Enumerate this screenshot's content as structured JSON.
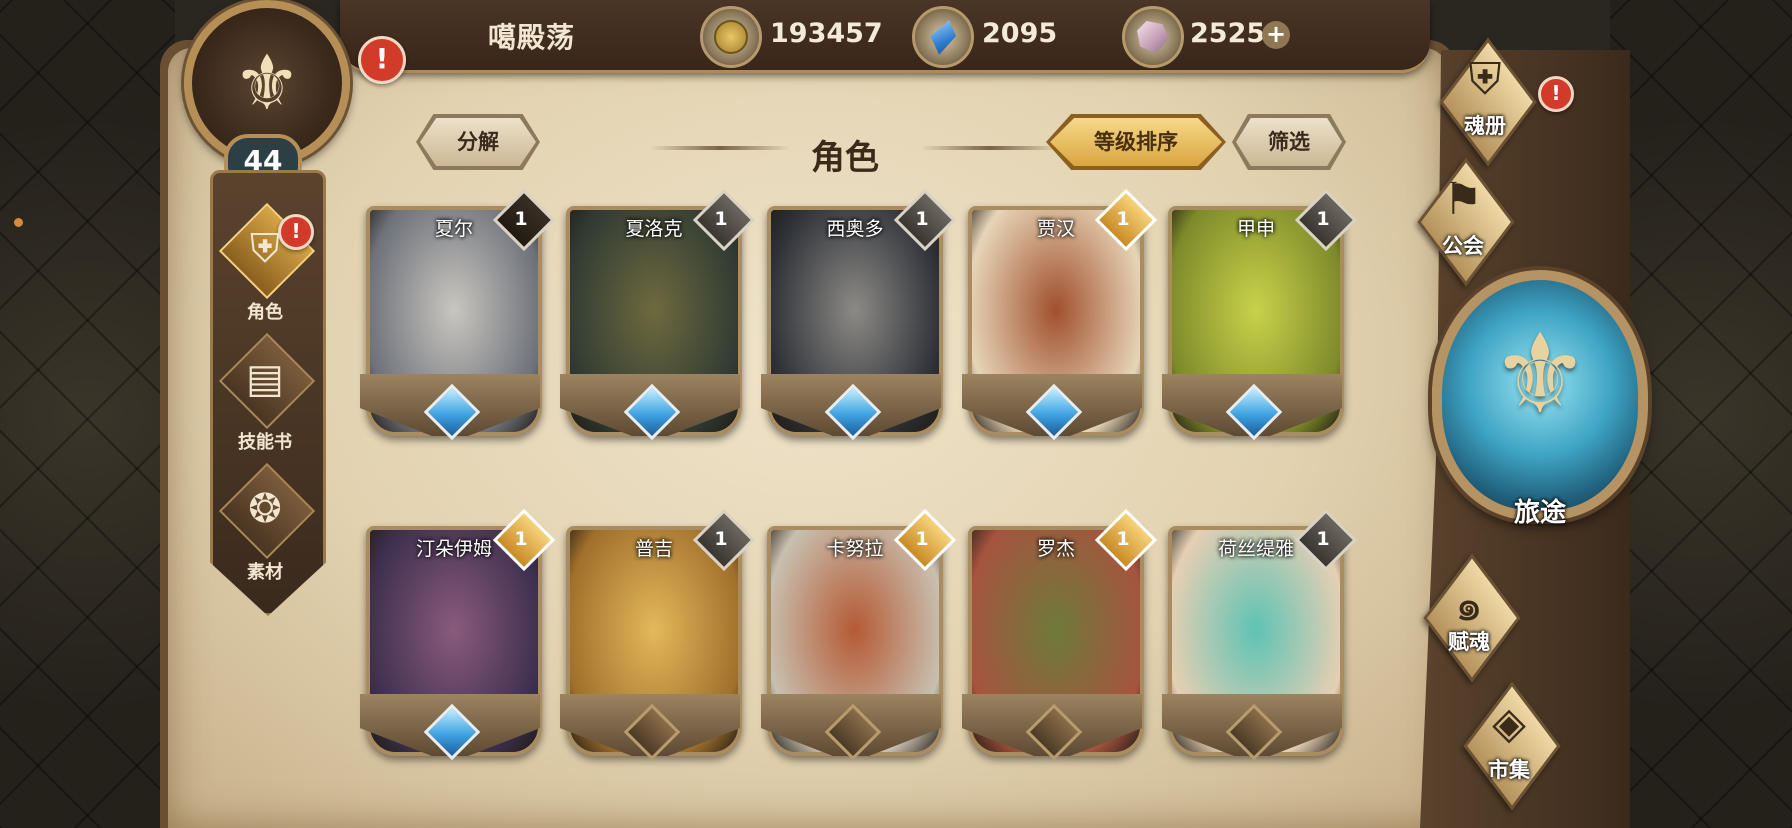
{
  "player": {
    "name": "噶殿荡",
    "level": "44",
    "alert": "!"
  },
  "resources": [
    {
      "icon": "gold-coin-icon",
      "value": "193457"
    },
    {
      "icon": "blue-gem-icon",
      "value": "2095"
    },
    {
      "icon": "crystal-icon",
      "value": "2525"
    }
  ],
  "plus_label": "+",
  "left_nav": [
    {
      "label": "角色",
      "icon": "helmet-icon",
      "alert": "!"
    },
    {
      "label": "技能书",
      "icon": "skill-book-icon"
    },
    {
      "label": "素材",
      "icon": "material-icon"
    }
  ],
  "toolbar": {
    "decompose": "分解",
    "sort": "等级排序",
    "filter": "筛选"
  },
  "page_title": "角色",
  "cards": [
    {
      "name": "夏尔",
      "count": "1",
      "tag": "dark",
      "gem": true,
      "colors": [
        "#c9c6c0",
        "#6d7179"
      ]
    },
    {
      "name": "夏洛克",
      "count": "1",
      "tag": "gray",
      "gem": true,
      "colors": [
        "#6e6a3e",
        "#2f3a33"
      ]
    },
    {
      "name": "西奥多",
      "count": "1",
      "tag": "gray",
      "gem": true,
      "colors": [
        "#8c8a86",
        "#2c2f35"
      ]
    },
    {
      "name": "贾汉",
      "count": "1",
      "tag": "gold",
      "gem": true,
      "colors": [
        "#a0502d",
        "#e7d5b8"
      ]
    },
    {
      "name": "甲申",
      "count": "1",
      "tag": "gray",
      "gem": true,
      "colors": [
        "#c9d24a",
        "#7d8a2a"
      ]
    },
    {
      "name": "汀朵伊姆",
      "count": "1",
      "tag": "gold",
      "gem": true,
      "colors": [
        "#8a5a7c",
        "#3c2f4e"
      ]
    },
    {
      "name": "普吉",
      "count": "1",
      "tag": "gray",
      "gem": false,
      "colors": [
        "#e4b85a",
        "#a06f2c"
      ]
    },
    {
      "name": "卡努拉",
      "count": "1",
      "tag": "gold",
      "gem": false,
      "colors": [
        "#b55a34",
        "#c8c0b0"
      ]
    },
    {
      "name": "罗杰",
      "count": "1",
      "tag": "gold",
      "gem": false,
      "colors": [
        "#6e7a3a",
        "#a6543f"
      ]
    },
    {
      "name": "荷丝缇雅",
      "count": "1",
      "tag": "gray",
      "gem": false,
      "colors": [
        "#5ec3b4",
        "#e6cfb3"
      ]
    }
  ],
  "right_nav": {
    "soul_book": {
      "label": "魂册",
      "icon": "helmet-icon",
      "alert": "!"
    },
    "guild": {
      "label": "公会",
      "icon": "guild-banner-icon"
    },
    "journey": {
      "label": "旅途",
      "icon": "trident-emblem-icon"
    },
    "talent": {
      "label": "赋魂",
      "icon": "spiral-icon"
    },
    "market": {
      "label": "市集",
      "icon": "gem-outline-icon"
    }
  }
}
